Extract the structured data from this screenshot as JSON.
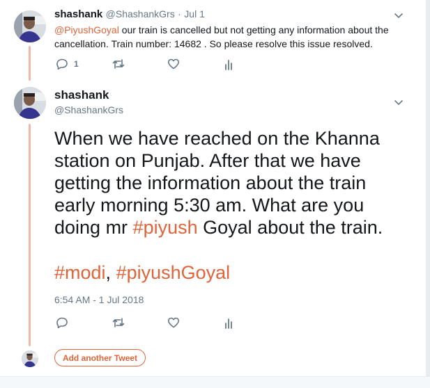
{
  "tweet1": {
    "name": "shashank",
    "handle": "@ShashankGrs",
    "separator": "·",
    "date": "Jul 1",
    "mention": "@PiyushGoyal",
    "text": " our train is cancelled but not getting any information about the cancellation. Train number: 14682 . So please resolve this issue resolved.",
    "reply_count": "1"
  },
  "tweet2": {
    "name": "shashank",
    "handle": "@ShashankGrs",
    "text_before": "When we have reached on the Khanna station on Punjab. After that we have getting the information about the train early morning 5:30 am. What are  you doing mr ",
    "hashtag_piyush": "#piyush",
    "text_after": " Goyal about the train.",
    "hashtag_modi": "#modi",
    "comma": ", ",
    "hashtag_piyushgoyal": "#piyushGoyal",
    "timestamp": "6:54 AM - 1 Jul 2018"
  },
  "compose": {
    "add_button_label": "Add another Tweet"
  },
  "icons": {
    "reply": "reply-icon",
    "retweet": "retweet-icon",
    "like": "heart-icon",
    "analytics": "analytics-icon",
    "more": "chevron-down-icon"
  },
  "colors": {
    "accent": "#e0633a",
    "thread_line": "#f0b9a5",
    "muted": "#657786"
  }
}
